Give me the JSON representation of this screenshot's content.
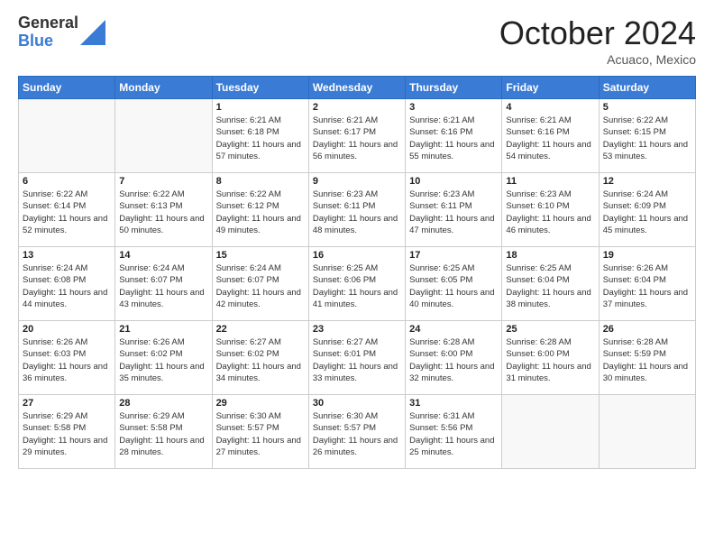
{
  "header": {
    "logo_general": "General",
    "logo_blue": "Blue",
    "month_title": "October 2024",
    "location": "Acuaco, Mexico"
  },
  "days_of_week": [
    "Sunday",
    "Monday",
    "Tuesday",
    "Wednesday",
    "Thursday",
    "Friday",
    "Saturday"
  ],
  "weeks": [
    [
      {
        "day": "",
        "sunrise": "",
        "sunset": "",
        "daylight": ""
      },
      {
        "day": "",
        "sunrise": "",
        "sunset": "",
        "daylight": ""
      },
      {
        "day": "1",
        "sunrise": "Sunrise: 6:21 AM",
        "sunset": "Sunset: 6:18 PM",
        "daylight": "Daylight: 11 hours and 57 minutes."
      },
      {
        "day": "2",
        "sunrise": "Sunrise: 6:21 AM",
        "sunset": "Sunset: 6:17 PM",
        "daylight": "Daylight: 11 hours and 56 minutes."
      },
      {
        "day": "3",
        "sunrise": "Sunrise: 6:21 AM",
        "sunset": "Sunset: 6:16 PM",
        "daylight": "Daylight: 11 hours and 55 minutes."
      },
      {
        "day": "4",
        "sunrise": "Sunrise: 6:21 AM",
        "sunset": "Sunset: 6:16 PM",
        "daylight": "Daylight: 11 hours and 54 minutes."
      },
      {
        "day": "5",
        "sunrise": "Sunrise: 6:22 AM",
        "sunset": "Sunset: 6:15 PM",
        "daylight": "Daylight: 11 hours and 53 minutes."
      }
    ],
    [
      {
        "day": "6",
        "sunrise": "Sunrise: 6:22 AM",
        "sunset": "Sunset: 6:14 PM",
        "daylight": "Daylight: 11 hours and 52 minutes."
      },
      {
        "day": "7",
        "sunrise": "Sunrise: 6:22 AM",
        "sunset": "Sunset: 6:13 PM",
        "daylight": "Daylight: 11 hours and 50 minutes."
      },
      {
        "day": "8",
        "sunrise": "Sunrise: 6:22 AM",
        "sunset": "Sunset: 6:12 PM",
        "daylight": "Daylight: 11 hours and 49 minutes."
      },
      {
        "day": "9",
        "sunrise": "Sunrise: 6:23 AM",
        "sunset": "Sunset: 6:11 PM",
        "daylight": "Daylight: 11 hours and 48 minutes."
      },
      {
        "day": "10",
        "sunrise": "Sunrise: 6:23 AM",
        "sunset": "Sunset: 6:11 PM",
        "daylight": "Daylight: 11 hours and 47 minutes."
      },
      {
        "day": "11",
        "sunrise": "Sunrise: 6:23 AM",
        "sunset": "Sunset: 6:10 PM",
        "daylight": "Daylight: 11 hours and 46 minutes."
      },
      {
        "day": "12",
        "sunrise": "Sunrise: 6:24 AM",
        "sunset": "Sunset: 6:09 PM",
        "daylight": "Daylight: 11 hours and 45 minutes."
      }
    ],
    [
      {
        "day": "13",
        "sunrise": "Sunrise: 6:24 AM",
        "sunset": "Sunset: 6:08 PM",
        "daylight": "Daylight: 11 hours and 44 minutes."
      },
      {
        "day": "14",
        "sunrise": "Sunrise: 6:24 AM",
        "sunset": "Sunset: 6:07 PM",
        "daylight": "Daylight: 11 hours and 43 minutes."
      },
      {
        "day": "15",
        "sunrise": "Sunrise: 6:24 AM",
        "sunset": "Sunset: 6:07 PM",
        "daylight": "Daylight: 11 hours and 42 minutes."
      },
      {
        "day": "16",
        "sunrise": "Sunrise: 6:25 AM",
        "sunset": "Sunset: 6:06 PM",
        "daylight": "Daylight: 11 hours and 41 minutes."
      },
      {
        "day": "17",
        "sunrise": "Sunrise: 6:25 AM",
        "sunset": "Sunset: 6:05 PM",
        "daylight": "Daylight: 11 hours and 40 minutes."
      },
      {
        "day": "18",
        "sunrise": "Sunrise: 6:25 AM",
        "sunset": "Sunset: 6:04 PM",
        "daylight": "Daylight: 11 hours and 38 minutes."
      },
      {
        "day": "19",
        "sunrise": "Sunrise: 6:26 AM",
        "sunset": "Sunset: 6:04 PM",
        "daylight": "Daylight: 11 hours and 37 minutes."
      }
    ],
    [
      {
        "day": "20",
        "sunrise": "Sunrise: 6:26 AM",
        "sunset": "Sunset: 6:03 PM",
        "daylight": "Daylight: 11 hours and 36 minutes."
      },
      {
        "day": "21",
        "sunrise": "Sunrise: 6:26 AM",
        "sunset": "Sunset: 6:02 PM",
        "daylight": "Daylight: 11 hours and 35 minutes."
      },
      {
        "day": "22",
        "sunrise": "Sunrise: 6:27 AM",
        "sunset": "Sunset: 6:02 PM",
        "daylight": "Daylight: 11 hours and 34 minutes."
      },
      {
        "day": "23",
        "sunrise": "Sunrise: 6:27 AM",
        "sunset": "Sunset: 6:01 PM",
        "daylight": "Daylight: 11 hours and 33 minutes."
      },
      {
        "day": "24",
        "sunrise": "Sunrise: 6:28 AM",
        "sunset": "Sunset: 6:00 PM",
        "daylight": "Daylight: 11 hours and 32 minutes."
      },
      {
        "day": "25",
        "sunrise": "Sunrise: 6:28 AM",
        "sunset": "Sunset: 6:00 PM",
        "daylight": "Daylight: 11 hours and 31 minutes."
      },
      {
        "day": "26",
        "sunrise": "Sunrise: 6:28 AM",
        "sunset": "Sunset: 5:59 PM",
        "daylight": "Daylight: 11 hours and 30 minutes."
      }
    ],
    [
      {
        "day": "27",
        "sunrise": "Sunrise: 6:29 AM",
        "sunset": "Sunset: 5:58 PM",
        "daylight": "Daylight: 11 hours and 29 minutes."
      },
      {
        "day": "28",
        "sunrise": "Sunrise: 6:29 AM",
        "sunset": "Sunset: 5:58 PM",
        "daylight": "Daylight: 11 hours and 28 minutes."
      },
      {
        "day": "29",
        "sunrise": "Sunrise: 6:30 AM",
        "sunset": "Sunset: 5:57 PM",
        "daylight": "Daylight: 11 hours and 27 minutes."
      },
      {
        "day": "30",
        "sunrise": "Sunrise: 6:30 AM",
        "sunset": "Sunset: 5:57 PM",
        "daylight": "Daylight: 11 hours and 26 minutes."
      },
      {
        "day": "31",
        "sunrise": "Sunrise: 6:31 AM",
        "sunset": "Sunset: 5:56 PM",
        "daylight": "Daylight: 11 hours and 25 minutes."
      },
      {
        "day": "",
        "sunrise": "",
        "sunset": "",
        "daylight": ""
      },
      {
        "day": "",
        "sunrise": "",
        "sunset": "",
        "daylight": ""
      }
    ]
  ]
}
